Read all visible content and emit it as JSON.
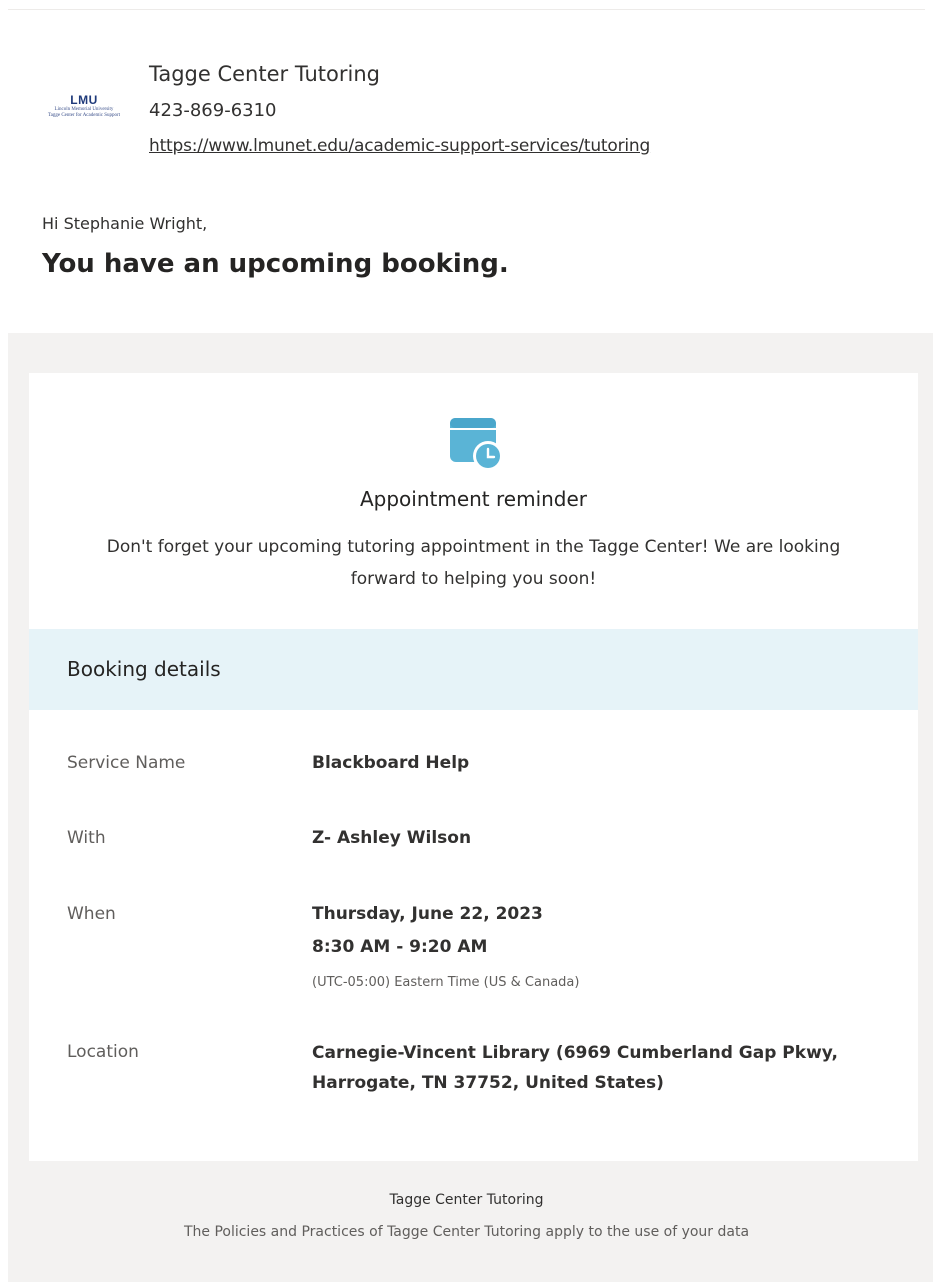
{
  "header": {
    "logo_text": "LMU",
    "logo_sub_line1": "Lincoln Memorial University",
    "logo_sub_line2": "Tagge Center for Academic Support",
    "org_name": "Tagge Center Tutoring",
    "phone": "423-869-6310",
    "website": "https://www.lmunet.edu/academic-support-services/tutoring"
  },
  "greeting": "Hi Stephanie Wright,",
  "headline": "You have an upcoming booking.",
  "reminder": {
    "icon": "calendar-clock-icon",
    "title": "Appointment reminder",
    "body": "Don't forget your upcoming tutoring appointment in the Tagge Center! We are looking forward to helping you soon!"
  },
  "details": {
    "title": "Booking details",
    "service": {
      "label": "Service Name",
      "value": "Blackboard Help"
    },
    "with": {
      "label": "With",
      "value": "Z- Ashley Wilson"
    },
    "when": {
      "label": "When",
      "date": "Thursday, June 22, 2023",
      "time": "8:30 AM - 9:20 AM",
      "timezone": "(UTC-05:00) Eastern Time (US & Canada)"
    },
    "location": {
      "label": "Location",
      "value": "Carnegie-Vincent Library (6969 Cumberland Gap Pkwy, Harrogate, TN 37752, United States)"
    }
  },
  "footer": {
    "name": "Tagge Center Tutoring",
    "policy": "The Policies and Practices of Tagge Center Tutoring apply to the use of your data"
  },
  "colors": {
    "accent_icon": "#5ab4d6",
    "details_bar": "#e6f3f8",
    "page_gray": "#f3f2f1"
  }
}
